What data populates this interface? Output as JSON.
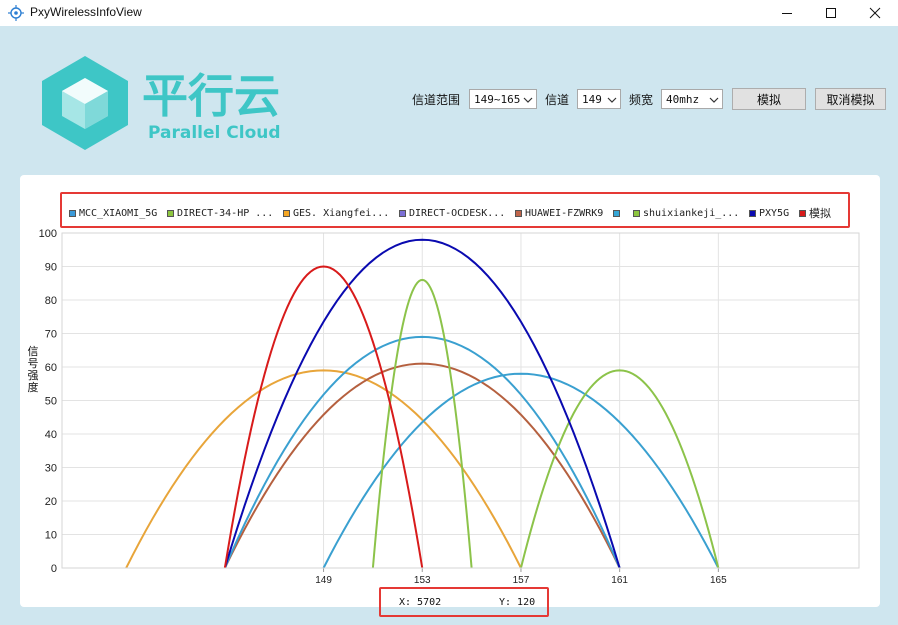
{
  "window": {
    "title": "PxyWirelessInfoView"
  },
  "logo": {
    "brand": "平行云",
    "subtitle": "Parallel Cloud",
    "color": "#3ec6c6"
  },
  "controls": {
    "channel_range_label": "信道范围",
    "channel_range_value": "149~165",
    "channel_label": "信道",
    "channel_value": "149",
    "bandwidth_label": "频宽",
    "bandwidth_value": "40mhz",
    "simulate_button": "模拟",
    "cancel_simulate_button": "取消模拟"
  },
  "legend": [
    {
      "name": "MCC_XIAOMI_5G",
      "color": "#3a9ad9"
    },
    {
      "name": "DIRECT-34-HP ...",
      "color": "#8dc63f"
    },
    {
      "name": "GES. Xiangfei...",
      "color": "#f5a623"
    },
    {
      "name": "DIRECT-OCDESK...",
      "color": "#7b6fd6"
    },
    {
      "name": "HUAWEI-FZWRK9",
      "color": "#c0654a"
    },
    {
      "name": "",
      "color": "#35a6d6"
    },
    {
      "name": "shuixiankeji_...",
      "color": "#8dc63f"
    },
    {
      "name": "PXY5G",
      "color": "#0a0ab0"
    },
    {
      "name": "模拟",
      "color": "#d81b1b"
    }
  ],
  "y_axis_label": [
    "信",
    "号",
    "强",
    "度"
  ],
  "coords": {
    "x": "X: 5702",
    "y": "Y: 120"
  },
  "chart_data": {
    "type": "area",
    "ylabel": "信号强度",
    "x_ticks": [
      149,
      153,
      157,
      161,
      165
    ],
    "y_ticks": [
      0,
      10,
      20,
      30,
      40,
      50,
      60,
      70,
      80,
      90,
      100
    ],
    "xlim": [
      138.4,
      170.7
    ],
    "ylim": [
      0,
      100
    ],
    "grid": true,
    "legend_placement": "top",
    "series": [
      {
        "name": "GES. Xiangfei...",
        "color": "#e8a53a",
        "from": 141,
        "to": 157,
        "peak": 59
      },
      {
        "name": "HUAWEI-FZWRK9",
        "color": "#b5603f",
        "from": 145,
        "to": 161,
        "peak": 61
      },
      {
        "name": "MCC_XIAOMI_5G",
        "color": "#3aa0d0",
        "from": 145,
        "to": 161,
        "peak": 69
      },
      {
        "name": "",
        "color": "#3aa0d0",
        "from": 149,
        "to": 165,
        "peak": 58
      },
      {
        "name": "DIRECT-34-HP ...",
        "color": "#8cc34a",
        "from": 151,
        "to": 155,
        "peak": 86
      },
      {
        "name": "shuixiankeji_...",
        "color": "#8cc34a",
        "from": 157,
        "to": 165,
        "peak": 59
      },
      {
        "name": "PXY5G",
        "color": "#0a0ab0",
        "from": 145,
        "to": 161,
        "peak": 98
      },
      {
        "name": "模拟",
        "color": "#d81b1b",
        "from": 145,
        "to": 153,
        "peak": 90
      }
    ]
  }
}
